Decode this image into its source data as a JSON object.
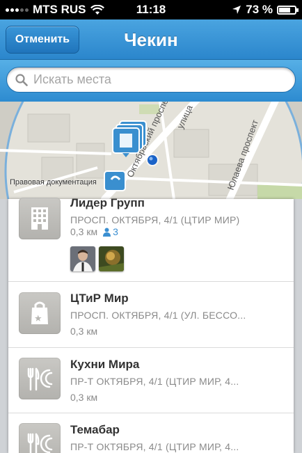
{
  "status_bar": {
    "carrier": "MTS RUS",
    "time": "11:18",
    "battery": "73 %",
    "battery_level": 0.73
  },
  "nav": {
    "cancel_label": "Отменить",
    "title": "Чекин"
  },
  "search": {
    "placeholder": "Искать места"
  },
  "map": {
    "legal_link": "Правовая документация",
    "street_labels": [
      "Октябрьский проспект",
      "улица",
      "Юлаева проспект"
    ]
  },
  "venues": [
    {
      "name": "Лидер Групп",
      "address": "ПРОСП. ОКТЯБРЯ, 4/1 (ЦТИР МИР)",
      "distance": "0,3 км",
      "people_count": "3",
      "icon": "building-icon"
    },
    {
      "name": "ЦТиР Мир",
      "address": "ПРОСП. ОКТЯБРЯ,  4/1 (УЛ. БЕССО...",
      "distance": "0,3 км",
      "icon": "shopping-bag-icon"
    },
    {
      "name": "Кухни Мира",
      "address": "ПР-Т ОКТЯБРЯ, 4/1 (ЦТИР МИР, 4...",
      "distance": "0,3 км",
      "icon": "restaurant-icon"
    },
    {
      "name": "Темабар",
      "address": "ПР-Т ОКТЯБРЯ, 4/1 (ЦТИР МИР, 4...",
      "icon": "restaurant-icon"
    }
  ],
  "colors": {
    "nav_blue": "#2b86cc",
    "accent_blue": "#3b8fd1",
    "text_dark": "#333333",
    "text_gray": "#8a8a8a"
  }
}
